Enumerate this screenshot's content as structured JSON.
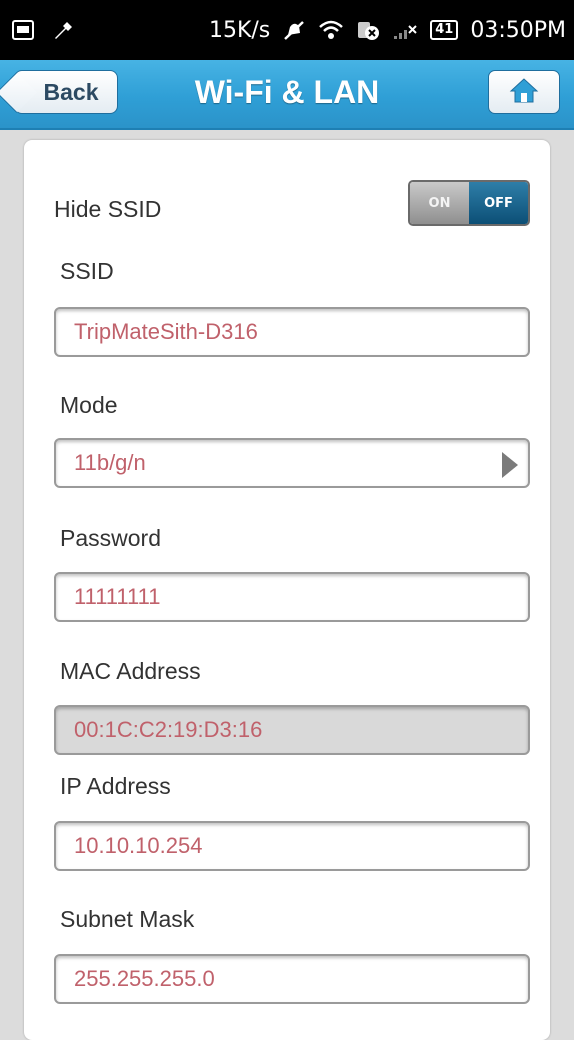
{
  "status_bar": {
    "speed": "15K/s",
    "battery": "41",
    "time": "03:50PM"
  },
  "header": {
    "back_label": "Back",
    "title": "Wi-Fi & LAN"
  },
  "form": {
    "hide_ssid": {
      "label": "Hide SSID",
      "on_label": "ON",
      "off_label": "OFF",
      "selected": "OFF"
    },
    "ssid": {
      "label": "SSID",
      "value": "TripMateSith-D316"
    },
    "mode": {
      "label": "Mode",
      "value": "11b/g/n"
    },
    "password": {
      "label": "Password",
      "value": "11111111"
    },
    "mac": {
      "label": "MAC Address",
      "value": "00:1C:C2:19:D3:16"
    },
    "ip": {
      "label": "IP Address",
      "value": "10.10.10.254"
    },
    "subnet": {
      "label": "Subnet Mask",
      "value": "255.255.255.0"
    }
  }
}
